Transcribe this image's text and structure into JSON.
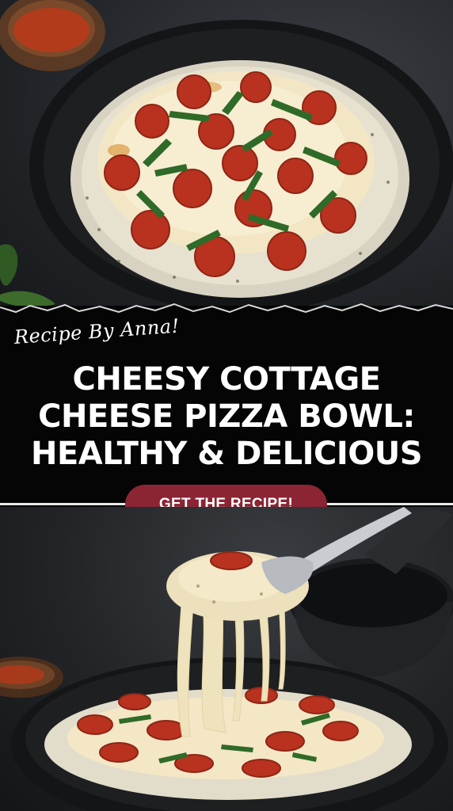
{
  "pin": {
    "byline": "Recipe By Anna!",
    "title_lines": [
      "CHEESY COTTAGE",
      "CHEESE PIZZA BOWL:",
      "HEALTHY & DELICIOUS"
    ],
    "cta_label": "GET THE RECIPE!"
  },
  "colors": {
    "band_background": "#050505",
    "cta_background": "#8b2433",
    "text": "#ffffff",
    "rule": "#e9e9e9"
  },
  "images": {
    "top_photo": "cottage-cheese-pizza-bowl-photo",
    "bottom_photo": "cheese-pull-spoon-photo"
  }
}
